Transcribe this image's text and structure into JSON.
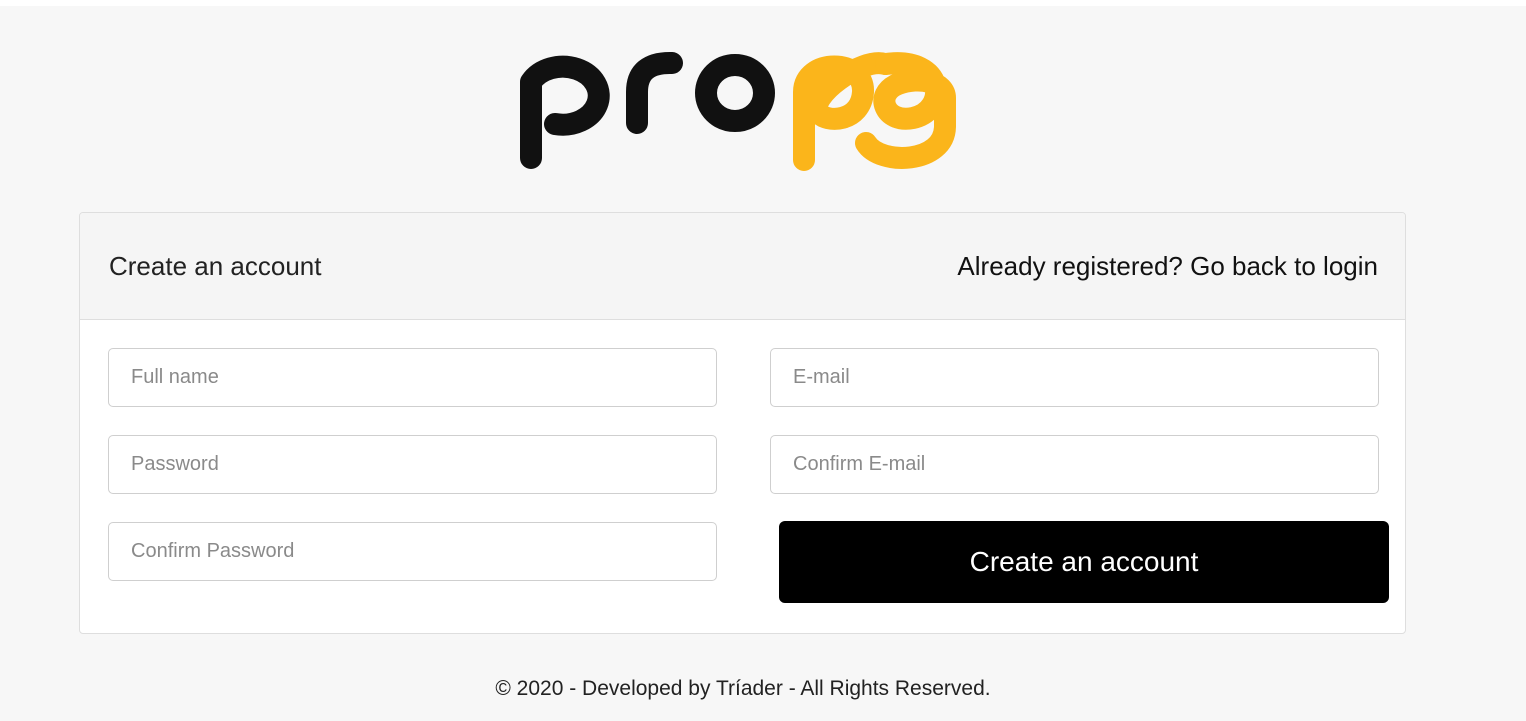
{
  "brand": {
    "name": "propg",
    "primary_color": "#111111",
    "accent_color": "#fbb51b"
  },
  "register": {
    "title": "Create an account",
    "login_link": "Already registered? Go back to login",
    "fields": {
      "full_name_placeholder": "Full name",
      "email_placeholder": "E-mail",
      "password_placeholder": "Password",
      "confirm_email_placeholder": "Confirm E-mail",
      "confirm_password_placeholder": "Confirm Password"
    },
    "submit_label": "Create an account"
  },
  "footer": {
    "prefix": "© 2020 - Developed by ",
    "developer": "Tríader",
    "suffix": " - All Rights Reserved."
  }
}
